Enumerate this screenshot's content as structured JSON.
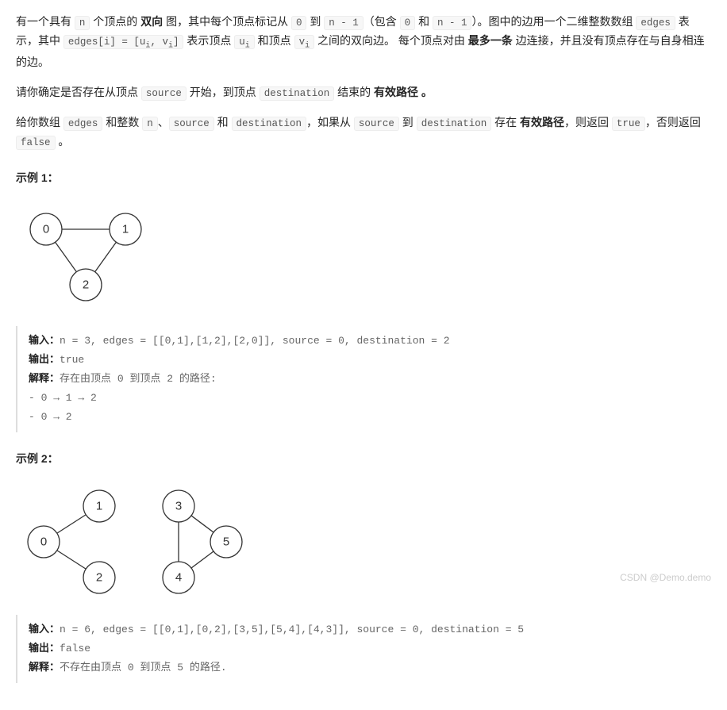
{
  "intro": {
    "p1_a": "有一个具有 ",
    "code_n": "n",
    "p1_b": " 个顶点的 ",
    "bold_bidir": "双向",
    "p1_c": " 图，其中每个顶点标记从 ",
    "code_0": "0",
    "p1_d": " 到 ",
    "code_nm1": "n - 1",
    "p1_e": "（包含 ",
    "code_0b": "0",
    "p1_f": " 和 ",
    "code_nm1b": "n - 1",
    "p1_g": "）。图中的边用一个二维整数数组 ",
    "code_edges": "edges",
    "p1_h": " 表示，其中 ",
    "code_edges_i": "edges[i] = [uᵢ, vᵢ]",
    "p1_i": " 表示顶点 ",
    "code_ui": "uᵢ",
    "p1_j": " 和顶点 ",
    "code_vi": "vᵢ",
    "p1_k": " 之间的双向边。 每个顶点对由 ",
    "bold_max1": "最多一条",
    "p1_l": " 边连接，并且没有顶点存在与自身相连的边。"
  },
  "para2": {
    "a": "请你确定是否存在从顶点 ",
    "code_src": "source",
    "b": " 开始，到顶点 ",
    "code_dest": "destination",
    "c": " 结束的 ",
    "bold_valid": "有效路径 。"
  },
  "para3": {
    "a": "给你数组 ",
    "code_edges": "edges",
    "b": " 和整数 ",
    "code_n": "n",
    "c": "、",
    "code_src": "source",
    "d": " 和 ",
    "code_dest": "destination",
    "e": "，如果从 ",
    "code_src2": "source",
    "f": " 到 ",
    "code_dest2": "destination",
    "g": " 存在 ",
    "bold_valid": "有效路径",
    "h": "，则返回 ",
    "code_true": "true",
    "i": "，否则返回 ",
    "code_false": "false",
    "j": " 。"
  },
  "ex1": {
    "title": "示例 1：",
    "input_label": "输入：",
    "input_val": "n = 3, edges = [[0,1],[1,2],[2,0]], source = 0, destination = 2",
    "output_label": "输出：",
    "output_val": "true",
    "explain_label": "解释：",
    "explain_val": "存在由顶点 0 到顶点 2 的路径:",
    "path1": "- 0 → 1 → 2",
    "path2": "- 0 → 2",
    "nodes": [
      "0",
      "1",
      "2"
    ]
  },
  "ex2": {
    "title": "示例 2：",
    "input_label": "输入：",
    "input_val": "n = 6, edges = [[0,1],[0,2],[3,5],[5,4],[4,3]], source = 0, destination = 5",
    "output_label": "输出：",
    "output_val": "false",
    "explain_label": "解释：",
    "explain_val": "不存在由顶点 0 到顶点 5 的路径.",
    "nodes": [
      "0",
      "1",
      "2",
      "3",
      "4",
      "5"
    ]
  },
  "watermark": "CSDN @Demo.demo"
}
